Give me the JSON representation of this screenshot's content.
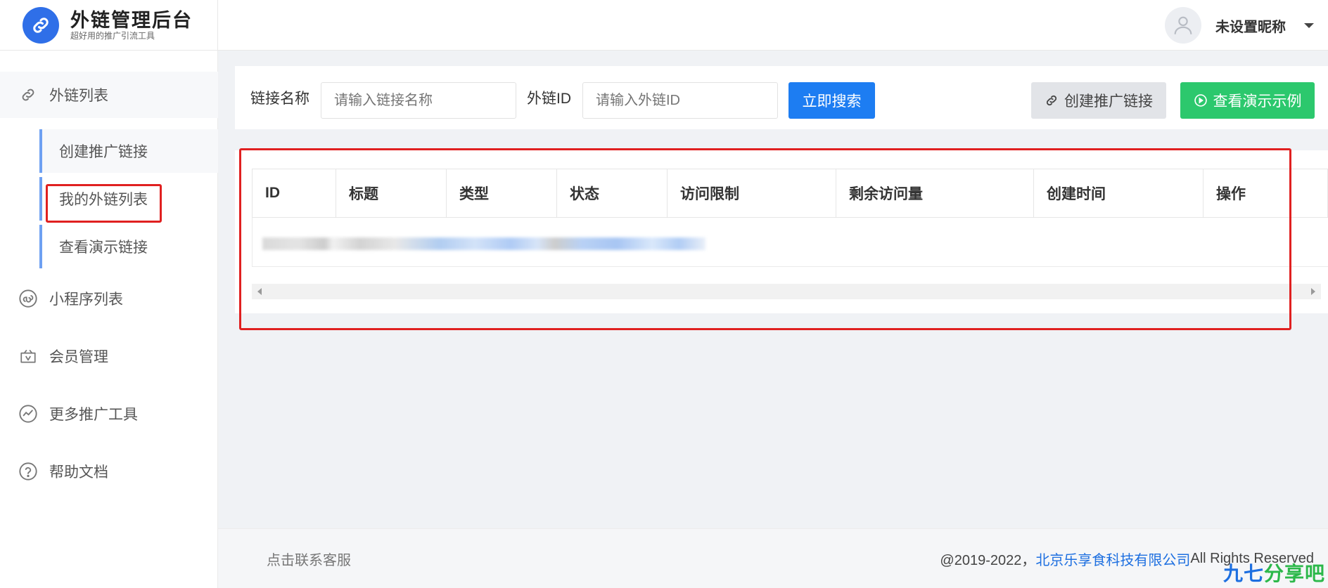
{
  "header": {
    "app_title": "外链管理后台",
    "app_subtitle": "超好用的推广引流工具",
    "nickname": "未设置昵称"
  },
  "sidebar": {
    "items": [
      {
        "label": "外链列表",
        "icon": "link-icon"
      },
      {
        "label": "小程序列表",
        "icon": "mini-program-icon"
      },
      {
        "label": "会员管理",
        "icon": "member-bag-icon"
      },
      {
        "label": "更多推广工具",
        "icon": "trend-chart-icon"
      },
      {
        "label": "帮助文档",
        "icon": "help-circle-icon"
      }
    ],
    "sub_items": [
      {
        "label": "创建推广链接"
      },
      {
        "label": "我的外链列表"
      },
      {
        "label": "查看演示链接"
      }
    ]
  },
  "search": {
    "name_label": "链接名称",
    "name_placeholder": "请输入链接名称",
    "id_label": "外链ID",
    "id_placeholder": "请输入外链ID",
    "search_button": "立即搜索",
    "create_button": "创建推广链接",
    "demo_button": "查看演示示例"
  },
  "table": {
    "columns": [
      "ID",
      "标题",
      "类型",
      "状态",
      "访问限制",
      "剩余访问量",
      "创建时间",
      "操作"
    ]
  },
  "footer": {
    "contact": "点击联系客服",
    "copyright_prefix": "@2019-2022，",
    "company": "北京乐享食科技有限公司",
    "rights": " All Rights Reserved"
  },
  "watermark": {
    "part1": "九七",
    "part2": "分享吧"
  },
  "colors": {
    "primary": "#1d7df2",
    "success": "#2cc86d",
    "highlight_box": "#e02020"
  }
}
